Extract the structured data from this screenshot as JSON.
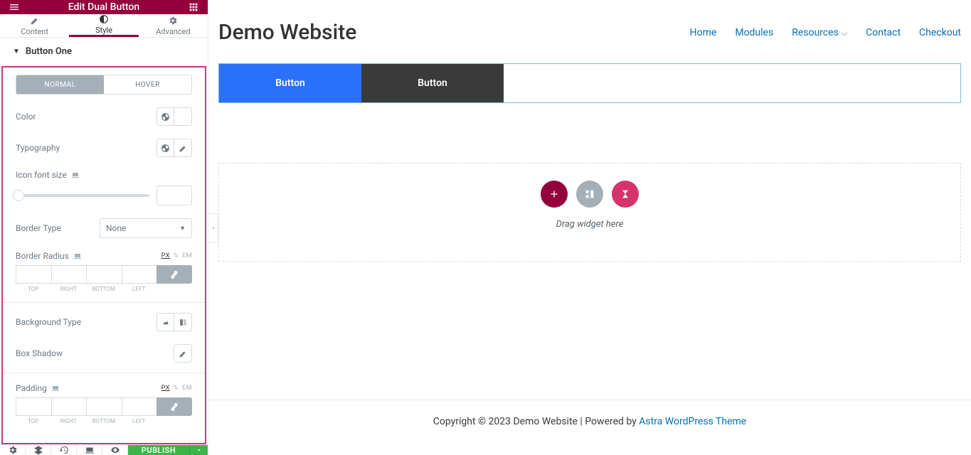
{
  "panel": {
    "title": "Edit Dual Button",
    "tabs": {
      "content": "Content",
      "style": "Style",
      "advanced": "Advanced"
    },
    "section": "Button One",
    "segments": {
      "normal": "NORMAL",
      "hover": "HOVER"
    },
    "labels": {
      "color": "Color",
      "typography": "Typography",
      "iconFontSize": "Icon font size",
      "borderType": "Border Type",
      "borderRadius": "Border Radius",
      "backgroundType": "Background Type",
      "boxShadow": "Box Shadow",
      "padding": "Padding"
    },
    "borderTypeValue": "None",
    "units": {
      "px": "PX",
      "pct": "%",
      "em": "EM"
    },
    "sides": {
      "top": "TOP",
      "right": "RIGHT",
      "bottom": "BOTTOM",
      "left": "LEFT"
    },
    "publish": "PUBLISH"
  },
  "site": {
    "title": "Demo Website",
    "nav": {
      "home": "Home",
      "modules": "Modules",
      "resources": "Resources",
      "contact": "Contact",
      "checkout": "Checkout"
    },
    "buttons": {
      "one": "Button",
      "two": "Button"
    },
    "dropText": "Drag widget here",
    "footer": {
      "text": "Copyright © 2023 Demo Website | Powered by ",
      "link": "Astra WordPress Theme"
    }
  }
}
